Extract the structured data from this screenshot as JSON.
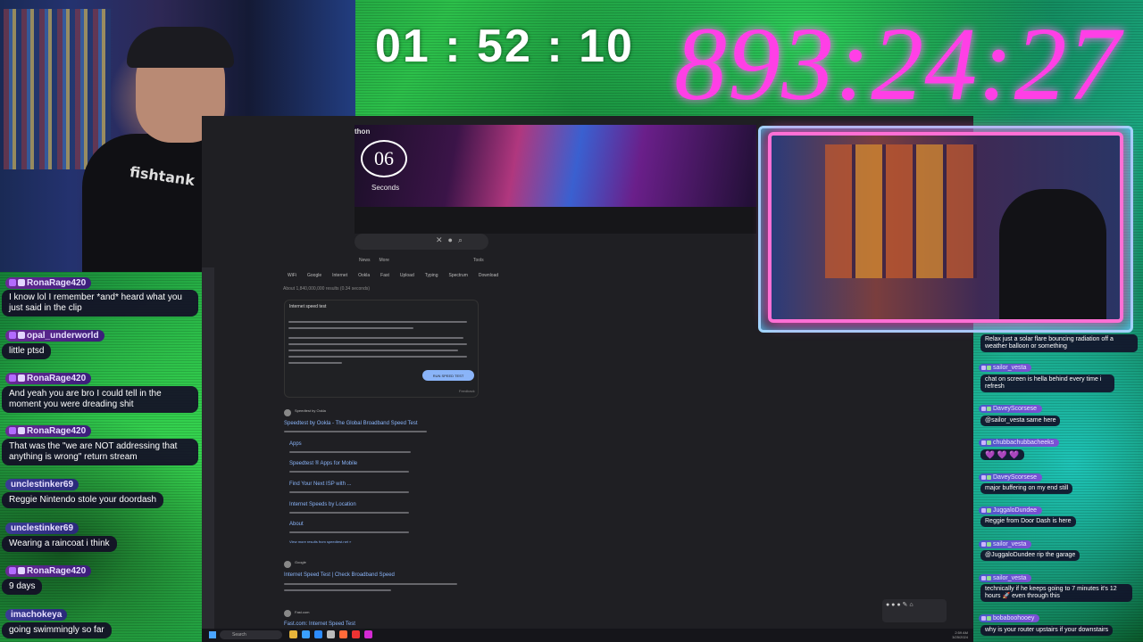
{
  "timers": {
    "elapsed": "01 : 52 : 10",
    "total": "893:24:27"
  },
  "webcam": {
    "shirt_text": "fishtank"
  },
  "browser": {
    "banner_title": "thon",
    "countdown_value": "06",
    "countdown_label": "Seconds",
    "search_tabs": [
      "WiFi",
      "Google",
      "Internet",
      "Ookla",
      "Fast",
      "Upload",
      "Typing",
      "Spectrum",
      "Download"
    ],
    "news_label": "News",
    "more_label": "More",
    "tools_label": "Tools",
    "result_count": "About 1,840,000,000 results (0.34 seconds)",
    "card_title": "Internet speed test",
    "run_button": "RUN SPEED TEST",
    "feedback": "Feedback",
    "results": [
      {
        "site": "Speedtest by Ookla",
        "title": "Speedtest by Ookla - The Global Broadband Speed Test"
      },
      {
        "site": "Google",
        "title": "Internet Speed Test | Check Broadband Speed"
      },
      {
        "site": "Fast.com",
        "title": "Fast.com: Internet Speed Test"
      }
    ],
    "sublinks": [
      "Apps",
      "Speedtest ® Apps for Mobile",
      "Find Your Next ISP with ...",
      "Internet Speeds by Location",
      "About"
    ],
    "more_results": "View more results from speedtest.net »"
  },
  "taskbar": {
    "search_label": "Search",
    "clock_time": "2:59 AM",
    "clock_date": "3/25/2024"
  },
  "chat_left": [
    {
      "user": "RonaRage420",
      "message": "I know lol I remember *and* heard what you just said in the clip"
    },
    {
      "user": "opal_underworld",
      "message": "little ptsd"
    },
    {
      "user": "RonaRage420",
      "message": "And yeah you are bro I could tell in the moment you were dreading shit"
    },
    {
      "user": "RonaRage420",
      "message": "That was the \"we are NOT addressing that anything is wrong\" return stream"
    },
    {
      "user": "unclestinker69",
      "message": "Reggie Nintendo stole your doordash"
    },
    {
      "user": "unclestinker69",
      "message": "Wearing a raincoat i think"
    },
    {
      "user": "RonaRage420",
      "message": "9 days"
    },
    {
      "user": "imachokeya",
      "message": "going swimmingly so far"
    }
  ],
  "chat_right": [
    {
      "user": "",
      "message": "Relax just a solar flare bouncing radiation off a weather balloon or something"
    },
    {
      "user": "sailor_vesta",
      "message": "chat on screen is hella behind every time i refresh"
    },
    {
      "user": "DaveyScorsese",
      "message": "@sailor_vesta same here"
    },
    {
      "user": "chubbachubbacheeks",
      "message": "💜 💜 💜"
    },
    {
      "user": "DaveyScorsese",
      "message": "major buffering on my end still"
    },
    {
      "user": "JuggaloDundee",
      "message": "Reggie from Door Dash is here"
    },
    {
      "user": "sailor_vesta",
      "message": "@JuggaloDundee rip the garage"
    },
    {
      "user": "sailor_vesta",
      "message": "technically if he keeps going to 7 minutes it's 12 hours 🚀 even through this"
    },
    {
      "user": "bobaboohooey",
      "message": "why is your router upstairs if your downstairs"
    }
  ],
  "colors": {
    "total_timer": "#ff3fe6",
    "guest_frame": "#ff6fd5",
    "link_blue": "#8ab4f8",
    "chat_name_bg": "#6a2a95"
  }
}
